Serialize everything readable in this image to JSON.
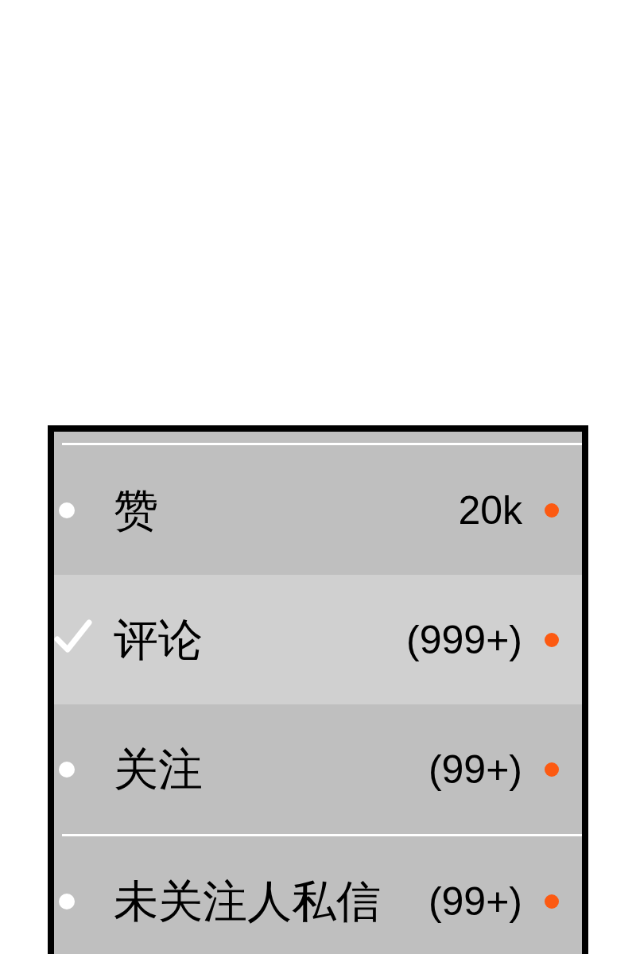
{
  "menu": {
    "sections": [
      {
        "items": [
          {
            "label": "赞",
            "count": "20k",
            "selected": false,
            "unread": true
          },
          {
            "label": "评论",
            "count": "(999+)",
            "selected": true,
            "unread": true
          },
          {
            "label": "关注",
            "count": "(99+)",
            "selected": false,
            "unread": true
          }
        ]
      },
      {
        "items": [
          {
            "label": "未关注人私信",
            "count": "(99+)",
            "selected": false,
            "unread": true
          }
        ]
      }
    ]
  }
}
